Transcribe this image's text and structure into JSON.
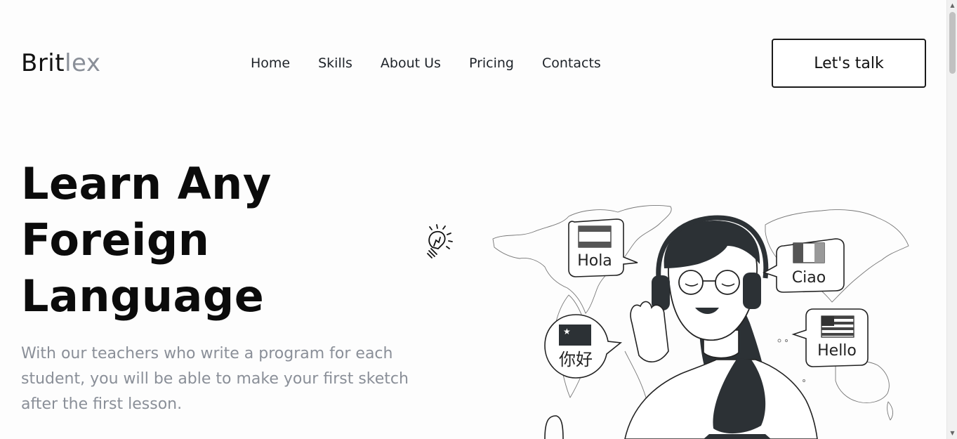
{
  "brand": {
    "part1": "Brit",
    "part2": "lex"
  },
  "nav": {
    "items": [
      {
        "label": "Home"
      },
      {
        "label": "Skills"
      },
      {
        "label": "About Us"
      },
      {
        "label": "Pricing"
      },
      {
        "label": "Contacts"
      }
    ]
  },
  "cta": {
    "label": "Let's talk"
  },
  "hero": {
    "title_line1": "Learn Any",
    "title_line2": "Foreign",
    "title_line3": "Language",
    "subtitle": "With our teachers who write a program for each student, you will be able to make your first sketch after the first lesson."
  },
  "illustration": {
    "bubbles": {
      "spanish": "Hola",
      "italian": "Ciao",
      "chinese": "你好",
      "english": "Hello"
    }
  },
  "colors": {
    "text_dark": "#111111",
    "text_muted": "#8a8f98",
    "illustration_dark": "#2c3135"
  }
}
